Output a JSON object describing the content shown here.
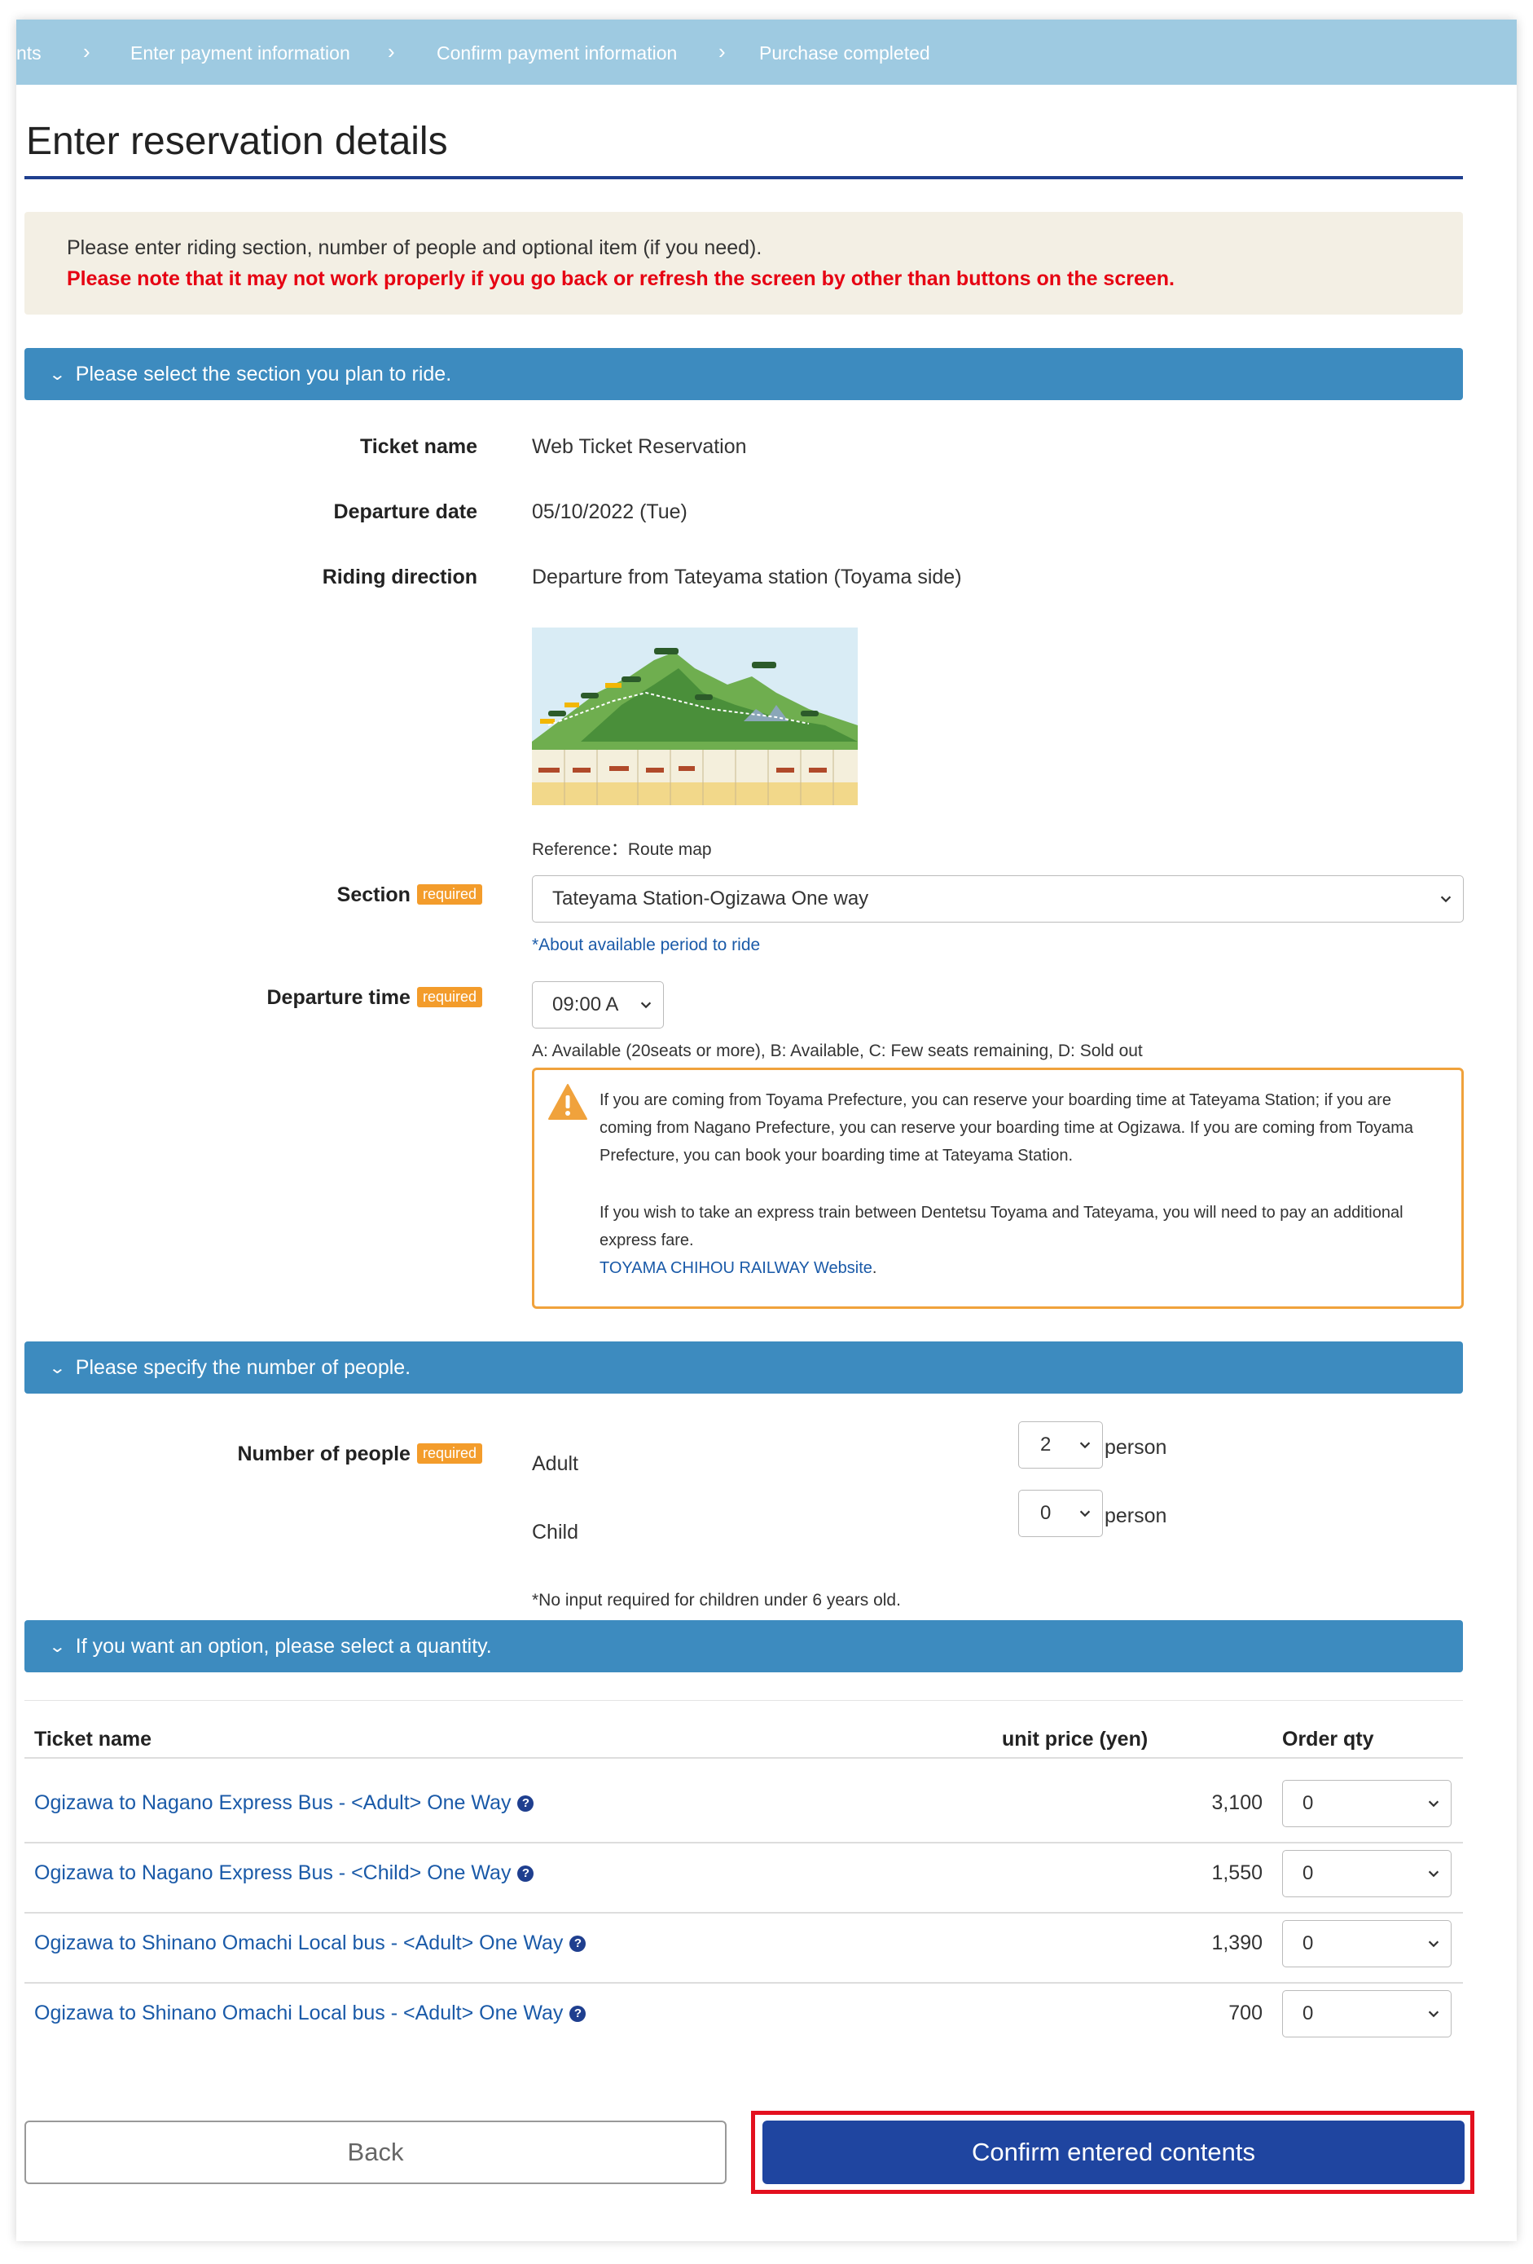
{
  "breadcrumb": {
    "items": [
      "nts",
      "Enter payment information",
      "Confirm payment information",
      "Purchase completed"
    ]
  },
  "page_title": "Enter reservation details",
  "notice": {
    "line1": "Please enter riding section, number of people and optional item (if you need).",
    "line2": "Please note that it may not work properly if you go back or refresh the screen by other than buttons on the screen."
  },
  "section1": {
    "header": "Please select the section you plan to ride.",
    "ticket_name_label": "Ticket name",
    "ticket_name_value": "Web Ticket Reservation",
    "departure_date_label": "Departure date",
    "departure_date_value": "05/10/2022 (Tue)",
    "riding_direction_label": "Riding direction",
    "riding_direction_value": "Departure from Tateyama station (Toyama side)",
    "map_caption": "Reference：Route map",
    "section_label": "Section",
    "required_badge": "required",
    "section_value": "Tateyama Station-Ogizawa One way",
    "period_link": "*About available period to ride",
    "departure_time_label": "Departure time",
    "departure_time_value": "09:00 A",
    "availability_legend": "A: Available (20seats or more), B: Available, C: Few seats remaining, D: Sold out",
    "warning_p1": "If you are coming from Toyama Prefecture, you can reserve your boarding time at Tateyama Station; if you are coming from Nagano Prefecture, you can reserve your boarding time at Ogizawa. If you are coming from Toyama Prefecture, you can book your boarding time at Tateyama Station.",
    "warning_p2": "If you wish to take an express train between Dentetsu Toyama and Tateyama, you will need to pay an additional express fare.",
    "warning_link": "TOYAMA CHIHOU RAILWAY Website",
    "warning_link_suffix": "."
  },
  "section2": {
    "header": "Please specify the number of people.",
    "label": "Number of people",
    "adult_label": "Adult",
    "adult_value": "2",
    "child_label": "Child",
    "child_value": "0",
    "unit": "person",
    "note": "*No input required for children under 6 years old."
  },
  "section3": {
    "header": "If you want an option, please select a quantity.",
    "col_ticket": "Ticket name",
    "col_price": "unit price (yen)",
    "col_qty": "Order qty",
    "rows": [
      {
        "name": "Ogizawa to Nagano Express Bus - <Adult> One Way",
        "price": "3,100",
        "qty": "0"
      },
      {
        "name": "Ogizawa to Nagano Express Bus - <Child> One Way",
        "price": "1,550",
        "qty": "0"
      },
      {
        "name": "Ogizawa to Shinano Omachi Local bus - <Adult> One Way",
        "price": "1,390",
        "qty": "0"
      },
      {
        "name": "Ogizawa to Shinano Omachi Local bus - <Adult> One Way",
        "price": "700",
        "qty": "0"
      }
    ]
  },
  "buttons": {
    "back": "Back",
    "confirm": "Confirm entered contents"
  },
  "colors": {
    "breadcrumb_bg": "#9ecae1",
    "section_bar": "#3d8bbf",
    "title_rule": "#1f3f8f",
    "notice_bg": "#f3efe4",
    "warning_text": "#e60012",
    "required_badge": "#f39c2b",
    "warning_border": "#f0a23c",
    "primary_button": "#1f45a0",
    "highlight_frame": "#e3101e",
    "link": "#1a5aa8"
  },
  "icons": {
    "breadcrumb_separator": "chevron-right-icon",
    "section_toggle": "chevron-down-icon",
    "warning": "warning-triangle-icon",
    "help": "question-circle-icon",
    "select_arrow": "chevron-down-icon"
  }
}
